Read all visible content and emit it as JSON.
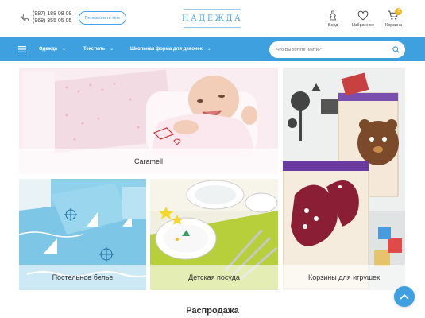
{
  "header": {
    "phones": [
      "(987) 188 08 08",
      "(968) 355 05 05"
    ],
    "callback_label": "Перезвоните мне",
    "logo_text": "НАДЕЖДА",
    "login_label": "Вход",
    "favorites_label": "Избранное",
    "cart_label": "Корзина",
    "cart_count": "0"
  },
  "nav": {
    "items": [
      {
        "label": "Одежда",
        "icon": "chevron-down-icon"
      },
      {
        "label": "Текстиль",
        "icon": "chevron-down-icon"
      },
      {
        "label": "Школьная форма для девочек",
        "icon": "chevron-down-icon"
      }
    ],
    "search_placeholder": "Что Вы хотите найти?"
  },
  "categories": [
    {
      "label": "Caramell"
    },
    {
      "label": "Постельное белье"
    },
    {
      "label": "Детская посуда"
    },
    {
      "label": "Корзины для игрушек"
    }
  ],
  "sale_title": "Распродажа",
  "colors": {
    "accent": "#3fa0df",
    "badge": "#f2b827"
  }
}
